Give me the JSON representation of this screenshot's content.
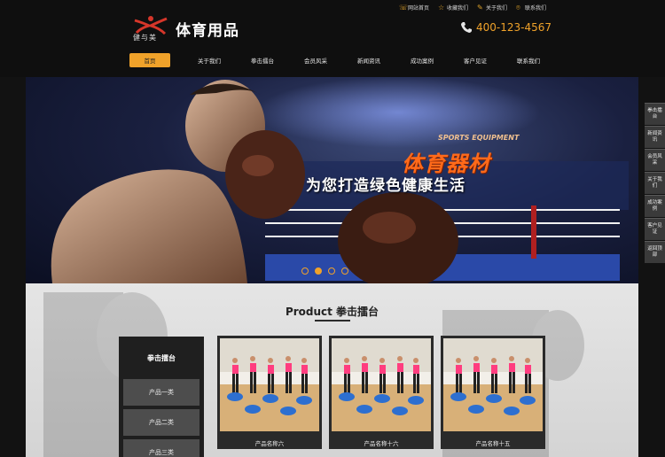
{
  "topbar": {
    "items": [
      {
        "label": "网站首页",
        "icon": "chat-icon"
      },
      {
        "label": "收藏我们",
        "icon": "star-icon"
      },
      {
        "label": "关于我们",
        "icon": "link-icon"
      },
      {
        "label": "联系我们",
        "icon": "location-icon"
      }
    ]
  },
  "logo": {
    "brand": "健与美",
    "title": "体育用品"
  },
  "phone": {
    "number": "400-123-4567",
    "icon": "phone-icon"
  },
  "nav": {
    "items": [
      {
        "label": "首页",
        "active": true
      },
      {
        "label": "关于我们"
      },
      {
        "label": "拳击擂台"
      },
      {
        "label": "会员风采"
      },
      {
        "label": "新闻资讯"
      },
      {
        "label": "成功案例"
      },
      {
        "label": "客户见证"
      },
      {
        "label": "联系我们"
      }
    ]
  },
  "banner": {
    "en": "SPORTS EQUIPMENT",
    "big": "体育器材",
    "slogan": "为您打造绿色健康生活",
    "slide_count": 4,
    "active_slide": 2
  },
  "float": {
    "items": [
      "拳击擂台",
      "新闻资讯",
      "会员风采",
      "关于我们",
      "成功案例",
      "客户见证",
      "返回顶部"
    ]
  },
  "products": {
    "title": "Product 拳击擂台",
    "category_title": "拳击擂台",
    "categories": [
      "产品一类",
      "产品二类",
      "产品三类"
    ],
    "cards": [
      {
        "name": "产品名称六"
      },
      {
        "name": "产品名称十六"
      },
      {
        "name": "产品名称十五"
      }
    ]
  },
  "colors": {
    "accent": "#f0a22a",
    "header_bg": "#0f0f0f",
    "banner_red": "#ff6a1a"
  }
}
